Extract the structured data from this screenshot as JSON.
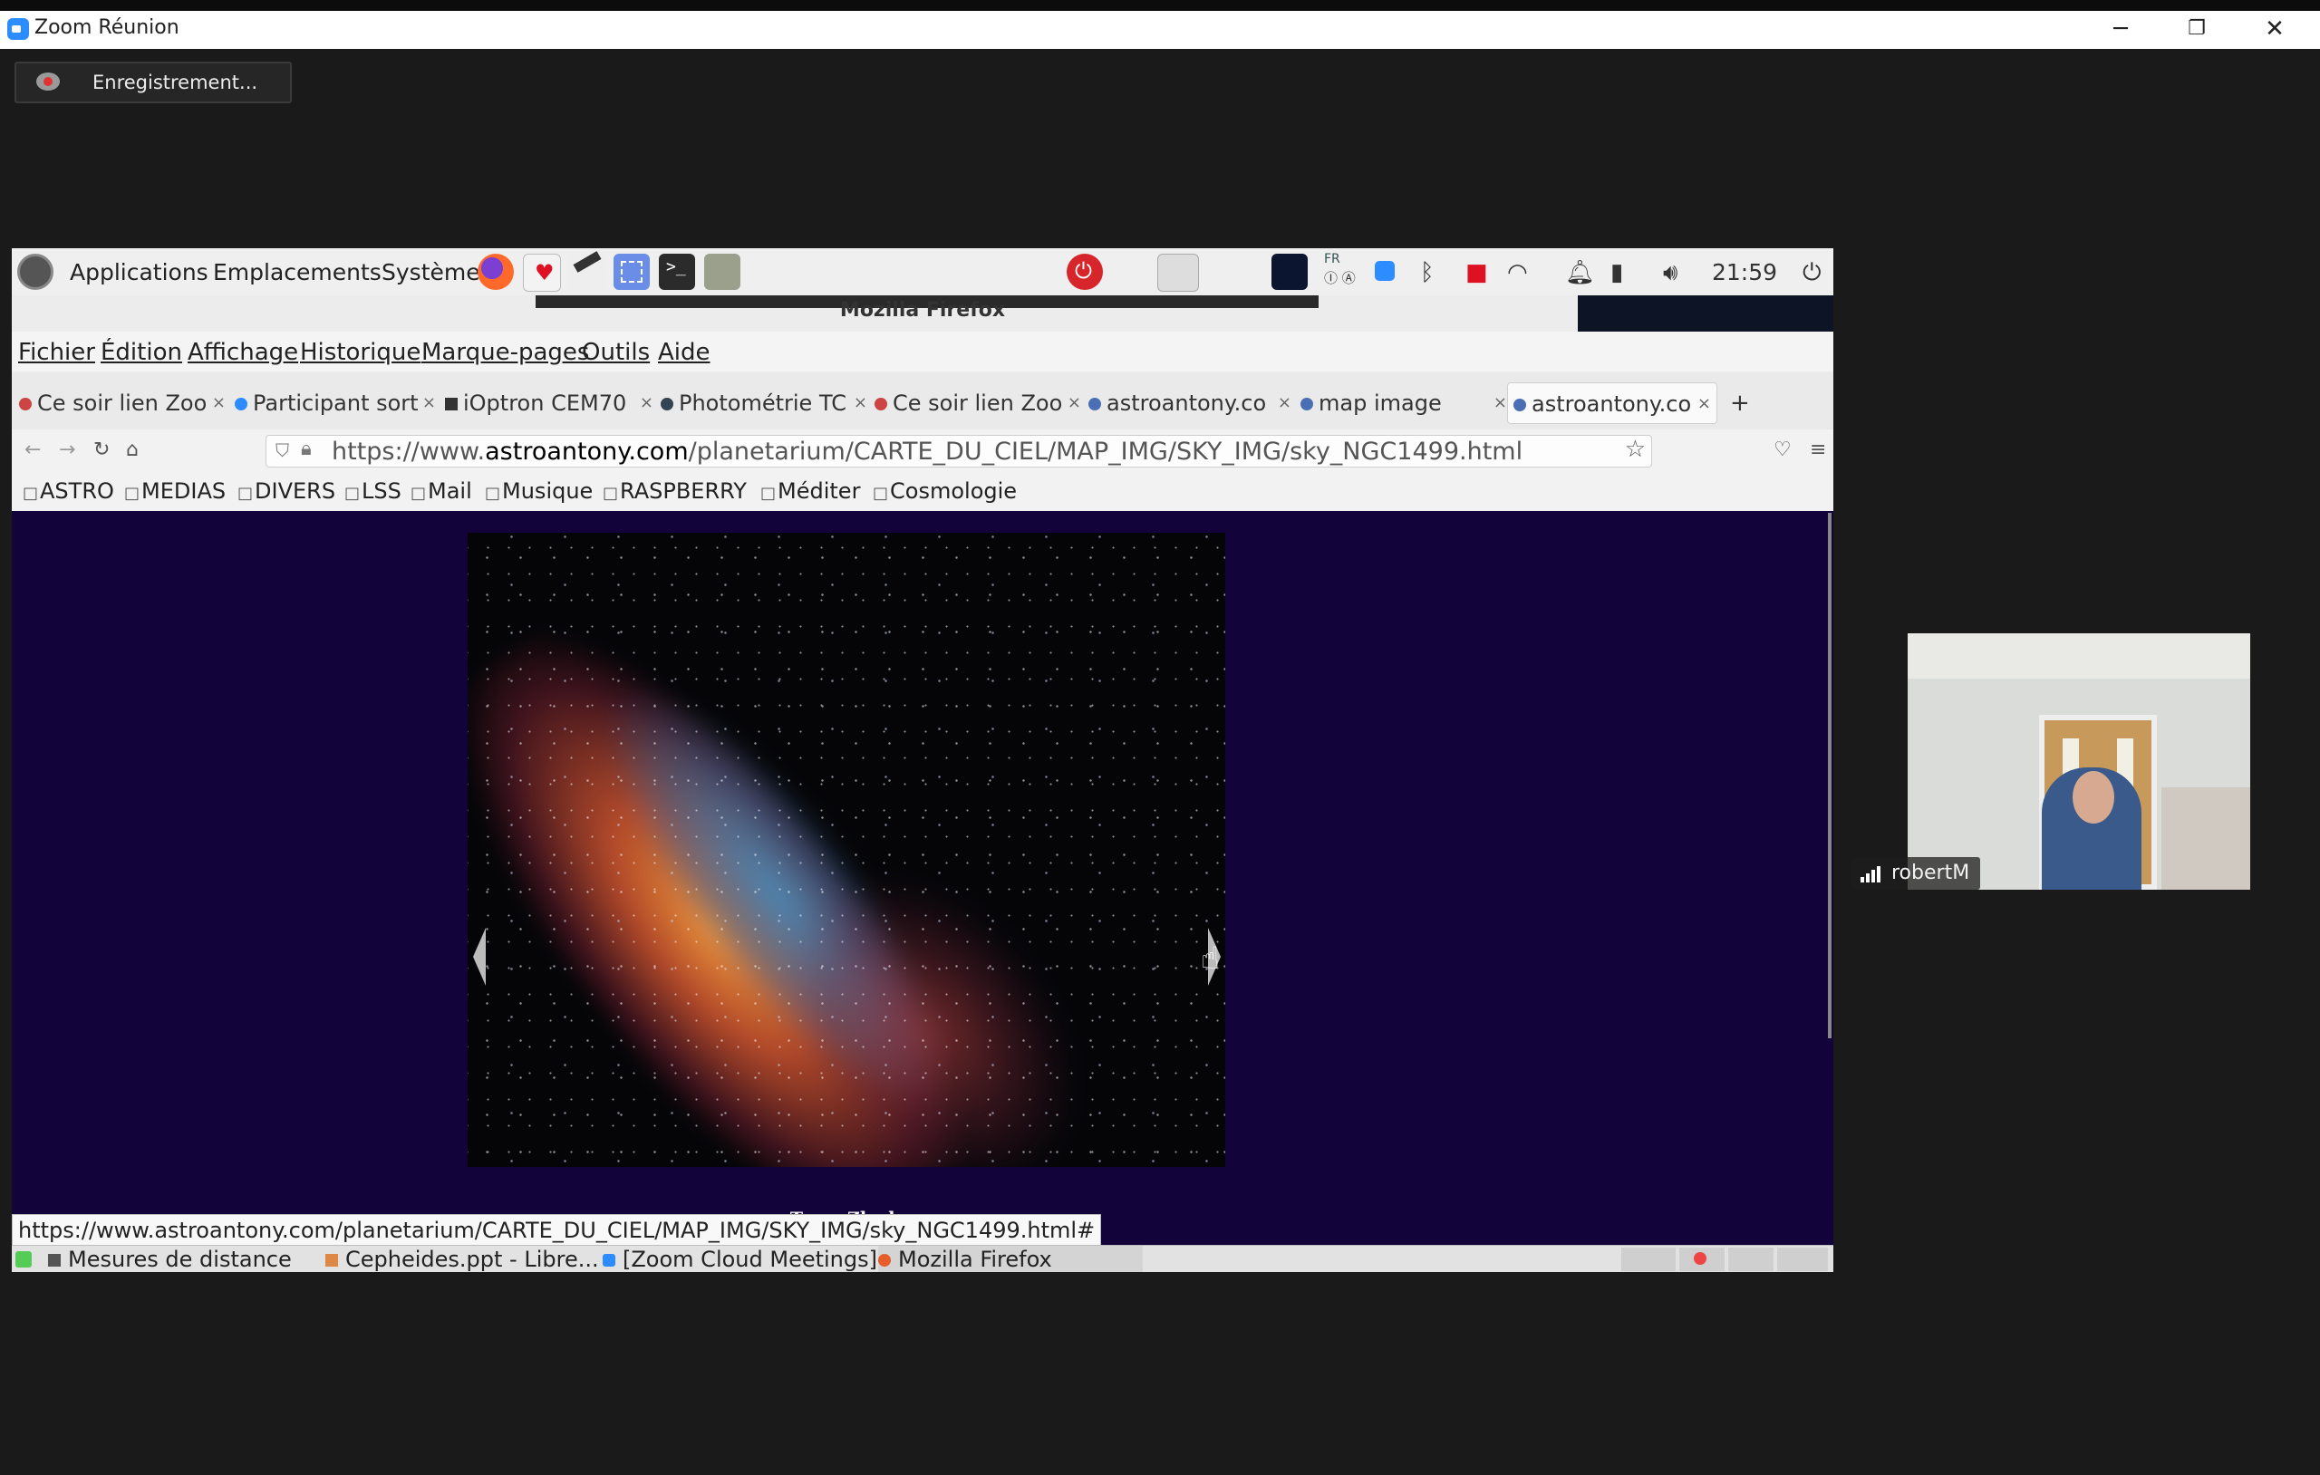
{
  "zoom": {
    "window_title": "Zoom Réunion",
    "recording_label": "Enregistrement...",
    "window_controls": {
      "minimize": "─",
      "restore": "❐",
      "close": "✕"
    }
  },
  "desktop_panel": {
    "menus": [
      "Applications",
      "Emplacements",
      "Système"
    ],
    "tray": {
      "keyboard": "FR",
      "clock": "21:59"
    }
  },
  "firefox": {
    "window_title": "Mozilla Firefox",
    "menu": [
      "Fichier",
      "Édition",
      "Affichage",
      "Historique",
      "Marque-pages",
      "Outils",
      "Aide"
    ],
    "tabs": [
      {
        "label": "Ce soir lien Zoo",
        "close": "×"
      },
      {
        "label": "Participant sort",
        "close": "×"
      },
      {
        "label": "iOptron CEM70",
        "close": "×"
      },
      {
        "label": "Photométrie TC",
        "close": "×"
      },
      {
        "label": "Ce soir lien Zoo",
        "close": "×"
      },
      {
        "label": "astroantony.co",
        "close": "×"
      },
      {
        "label": "map image",
        "close": "×"
      },
      {
        "label": "astroantony.co",
        "close": "×"
      }
    ],
    "new_tab": "+",
    "url": {
      "prefix": "https://www.",
      "domain": "astroantony.com",
      "path": "/planetarium/CARTE_DU_CIEL/MAP_IMG/SKY_IMG/sky_NGC1499.html"
    },
    "nav": {
      "back": "←",
      "forward": "→",
      "reload": "↻",
      "home": "⌂",
      "bookmark_star": "☆",
      "pocket": "♡",
      "menu": "≡"
    },
    "bookmarks": [
      "ASTRO",
      "MEDIAS",
      "DIVERS",
      "LSS",
      "Mail",
      "Musique",
      "RASPBERRY",
      "Méditer",
      "Cosmologie"
    ],
    "page": {
      "caption": "Team Zloch",
      "image_alt": "NGC1499 nebula"
    },
    "status_url": "https://www.astroantony.com/planetarium/CARTE_DU_CIEL/MAP_IMG/SKY_IMG/sky_NGC1499.html#"
  },
  "taskbar": {
    "items": [
      "Mesures de distance",
      "Cepheides.ppt - Libre...",
      "[Zoom Cloud Meetings]",
      "Mozilla Firefox"
    ]
  },
  "participant": {
    "name": "robertM"
  },
  "colors": {
    "page_bg": "#12033a",
    "accent_zoom": "#2d8cff",
    "power_red": "#d7262b"
  }
}
